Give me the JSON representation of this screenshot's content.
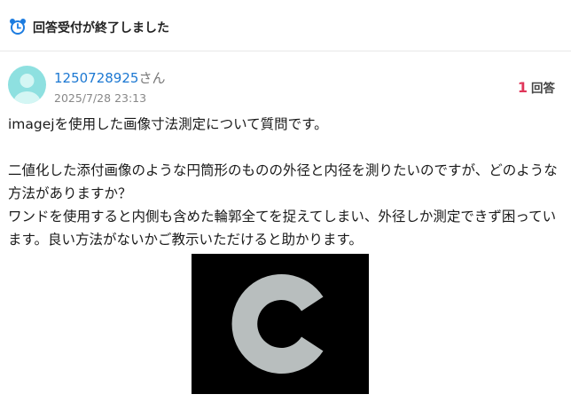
{
  "status": {
    "icon": "alarm-clock-icon",
    "text": "回答受付が終了しました"
  },
  "user": {
    "avatar_icon": "default-avatar-icon",
    "name": "1250728925",
    "honorific": "さん",
    "date": "2025/7/28 23:13"
  },
  "answers": {
    "count": "1",
    "label": "回答"
  },
  "question": {
    "line1": "imagejを使用した画像寸法測定について質問です。",
    "line2": "二値化した添付画像のような円筒形のものの外径と内径を測りたいのですが、どのような方法がありますか？",
    "line3": "ワンドを使用すると内側も含めた輪郭全てを捉えてしまい、外径しか測定できず困っています。良い方法がないかご教示いただけると助かります。"
  },
  "attachment": {
    "description_icon": "ring-image",
    "background": "#000000",
    "ring_color": "#b8bebe"
  },
  "colors": {
    "accent_blue": "#1c78d2",
    "count_red": "#e0365a",
    "avatar_bg": "#8ee0e0"
  }
}
